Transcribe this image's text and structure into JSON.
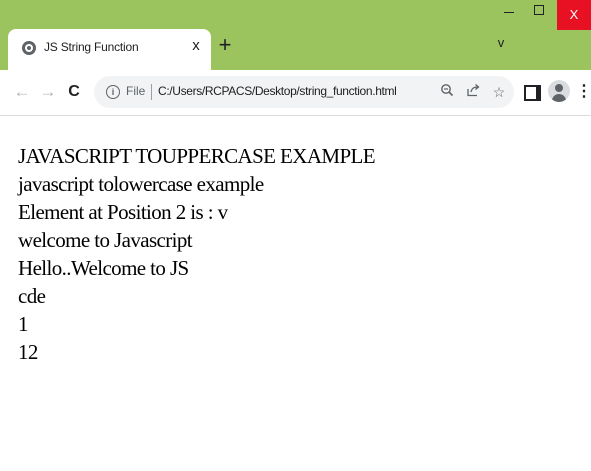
{
  "window": {
    "minimize_icon": "minimize-icon",
    "maximize_icon": "maximize-icon",
    "close_label": "X",
    "titlebar_color": "#9cc45e",
    "close_color": "#e81123"
  },
  "tab": {
    "title": "JS String Function",
    "close_label": "x",
    "favicon": "globe-icon"
  },
  "tabstrip": {
    "new_tab_label": "+",
    "tab_search_label": "v"
  },
  "toolbar": {
    "back_icon": "arrow-left-icon",
    "forward_icon": "arrow-right-icon",
    "reload_label": "C",
    "scheme_label": "File",
    "url": "C:/Users/RCPACS/Desktop/string_function.html",
    "zoom_icon": "zoom-icon",
    "share_icon": "share-icon",
    "star_icon": "star-icon",
    "sidepanel_icon": "side-panel-icon",
    "profile_icon": "profile-icon",
    "menu_icon": "kebab-menu-icon"
  },
  "page": {
    "lines": [
      "JAVASCRIPT TOUPPERCASE EXAMPLE",
      "javascript tolowercase example",
      "Element at Position 2 is : v",
      "welcome to Javascript",
      "Hello..Welcome to JS",
      "cde",
      "1",
      "12"
    ]
  }
}
